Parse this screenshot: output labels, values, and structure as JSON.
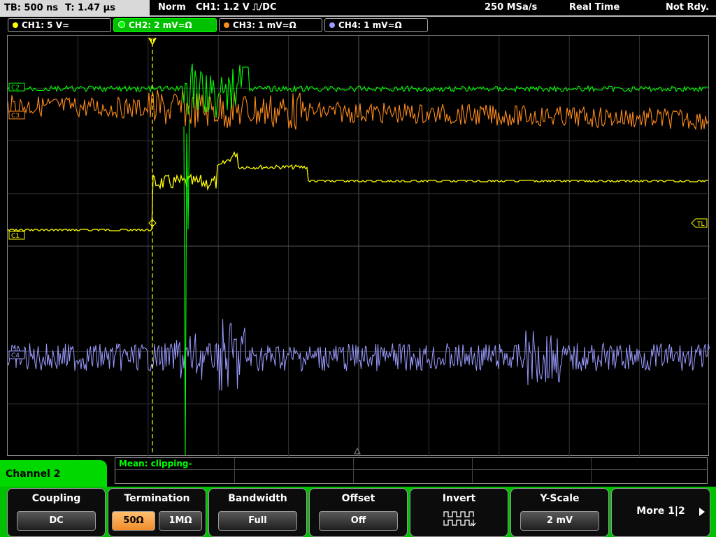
{
  "topbar": {
    "timebase": "TB: 500 ns",
    "trigger_time": "T: 1.47 µs",
    "mode": "Norm",
    "trigger_info": "CH1: 1.2 V ⎍/DC",
    "sample_rate": "250 MSa/s",
    "acq_mode": "Real Time",
    "status": "Not Rdy."
  },
  "channels": [
    {
      "label": "CH1: 5 V≃",
      "color": "#ffff00"
    },
    {
      "label": "CH2: 2 mV≃Ω",
      "color": "#00ff00"
    },
    {
      "label": "CH3: 1 mV≃Ω",
      "color": "#ff8c1a"
    },
    {
      "label": "CH4: 1 mV≃Ω",
      "color": "#9a9aff"
    }
  ],
  "markers": {
    "c1": "C1",
    "c2": "C2",
    "c3": "C3",
    "c4": "C4",
    "trigger_level": "TL",
    "trigger_pos": "T"
  },
  "measurement": {
    "text": "Mean: clipping-"
  },
  "menu": {
    "title": "Channel 2"
  },
  "softkeys": {
    "coupling": {
      "title": "Coupling",
      "value": "DC"
    },
    "termination": {
      "title": "Termination",
      "opt1": "50Ω",
      "opt2": "1MΩ"
    },
    "bandwidth": {
      "title": "Bandwidth",
      "value": "Full"
    },
    "offset": {
      "title": "Offset",
      "value": "Off"
    },
    "invert": {
      "title": "Invert"
    },
    "yscale": {
      "title": "Y-Scale",
      "value": "2 mV"
    },
    "more": {
      "label": "More 1|2"
    }
  }
}
